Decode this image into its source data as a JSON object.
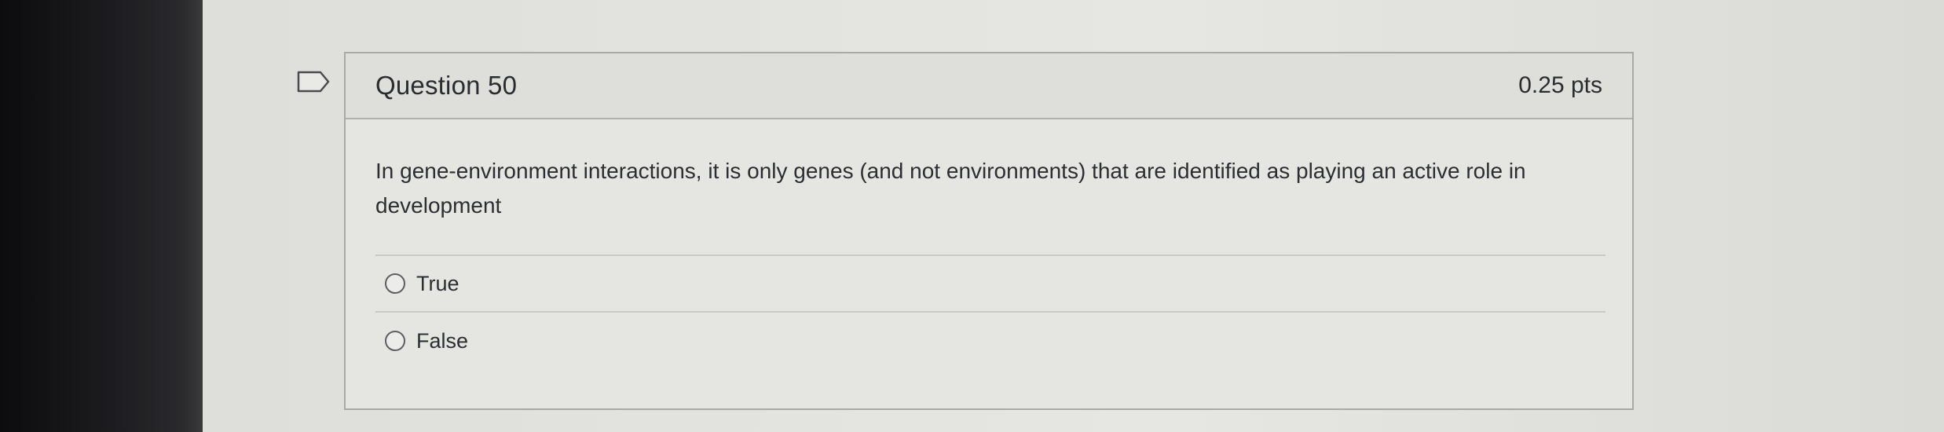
{
  "question": {
    "title": "Question 50",
    "points": "0.25 pts",
    "text": "In gene-environment interactions, it is only genes (and not environments) that are identified as playing an active role in development",
    "flag_icon": "flag-outline-icon",
    "answers": [
      {
        "label": "True",
        "selected": false
      },
      {
        "label": "False",
        "selected": false
      }
    ]
  }
}
